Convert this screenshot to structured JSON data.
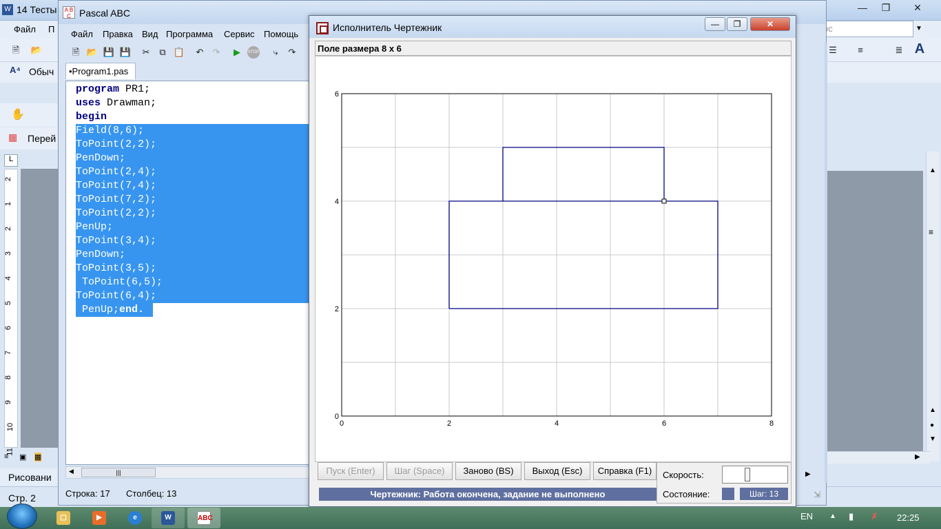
{
  "word": {
    "title": "14 Тесты",
    "menu_file": "Файл",
    "menu_edit_partial": "П",
    "style_box": "Обыч",
    "goto_label": "Перей",
    "search_placeholder": "ос",
    "draw_label": "Рисовани",
    "status_page": "Стр. 2",
    "ruler_numbers": [
      "2",
      "1",
      "2",
      "3",
      "4",
      "5",
      "6",
      "7",
      "8",
      "9",
      "10",
      "11"
    ]
  },
  "pascal": {
    "title": "Pascal ABC",
    "menu": [
      "Файл",
      "Правка",
      "Вид",
      "Программа",
      "Сервис",
      "Помощь"
    ],
    "tab": "•Program1.pas",
    "code": [
      {
        "kw": "program",
        "rest": " PR1;"
      },
      {
        "kw": "uses",
        "rest": " Drawman;"
      },
      {
        "kw": "begin",
        "rest": ""
      },
      {
        "sel": "Field(8,6);"
      },
      {
        "sel": "ToPoint(2,2);"
      },
      {
        "sel": "PenDown;"
      },
      {
        "sel": "ToPoint(2,4);"
      },
      {
        "sel": "ToPoint(7,4);"
      },
      {
        "sel": "ToPoint(7,2);"
      },
      {
        "sel": "ToPoint(2,2);"
      },
      {
        "sel": "PenUp;"
      },
      {
        "sel": "ToPoint(3,4);"
      },
      {
        "sel": "PenDown;"
      },
      {
        "sel": "ToPoint(3,5);"
      },
      {
        "sel": " ToPoint(6,5);"
      },
      {
        "sel": "ToPoint(6,4);"
      },
      {
        "sel": " PenUp;",
        "kw_end": "end."
      }
    ],
    "status_line": "Строка: 17",
    "status_col": "Столбец: 13"
  },
  "drawman": {
    "title": "Исполнитель Чертежник",
    "field_label": "Поле размера 8 x 6",
    "grid": {
      "cols": 8,
      "rows": 6
    },
    "x_ticks": [
      "0",
      "2",
      "4",
      "6",
      "8"
    ],
    "y_ticks": [
      "0",
      "2",
      "4",
      "6"
    ],
    "path1": [
      [
        2,
        2
      ],
      [
        2,
        4
      ],
      [
        7,
        4
      ],
      [
        7,
        2
      ],
      [
        2,
        2
      ]
    ],
    "path2": [
      [
        3,
        4
      ],
      [
        3,
        5
      ],
      [
        6,
        5
      ],
      [
        6,
        4
      ]
    ],
    "pen_pos": [
      6,
      4
    ],
    "line_color": "#000080",
    "buttons": {
      "run": "Пуск (Enter)",
      "step": "Шаг (Space)",
      "restart": "Заново (BS)",
      "exit": "Выход (Esc)",
      "help": "Справка (F1)"
    },
    "speed_label": "Скорость:",
    "state_label": "Состояние:",
    "step_count": "Шаг: 13",
    "status_message": "Чертежник: Работа окончена, задание не выполнено"
  },
  "taskbar": {
    "lang": "EN",
    "time": "22:25"
  }
}
